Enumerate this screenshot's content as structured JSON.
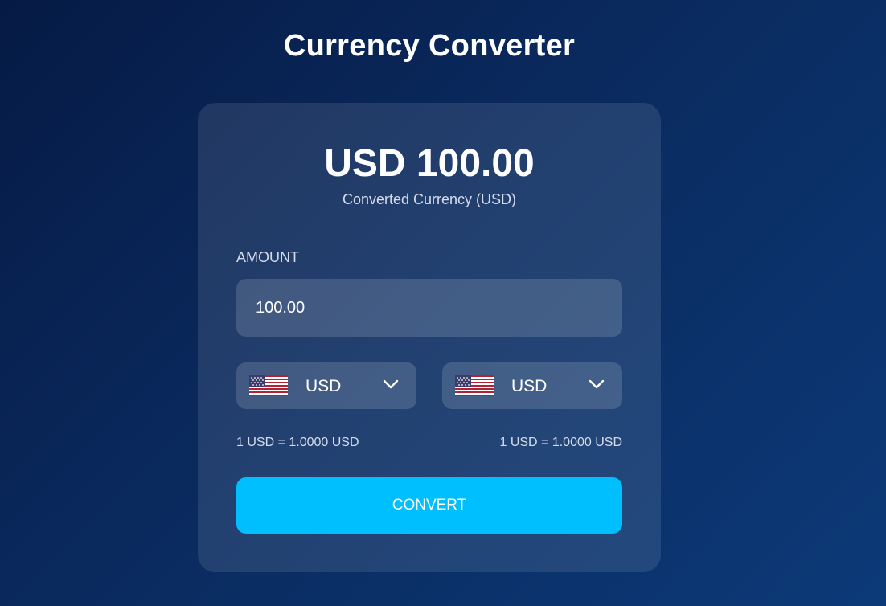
{
  "header": {
    "title": "Currency Converter"
  },
  "result": {
    "amount": "USD 100.00",
    "label": "Converted Currency (USD)"
  },
  "amount": {
    "label": "AMOUNT",
    "value": "100.00"
  },
  "from_currency": {
    "code": "USD",
    "flag_icon": "us-flag-icon",
    "rate_text": "1 USD = 1.0000 USD"
  },
  "to_currency": {
    "code": "USD",
    "flag_icon": "us-flag-icon",
    "rate_text": "1 USD = 1.0000 USD"
  },
  "actions": {
    "convert_label": "CONVERT"
  },
  "colors": {
    "accent": "#00bfff",
    "background_start": "#061a45",
    "background_end": "#0c3a78"
  }
}
